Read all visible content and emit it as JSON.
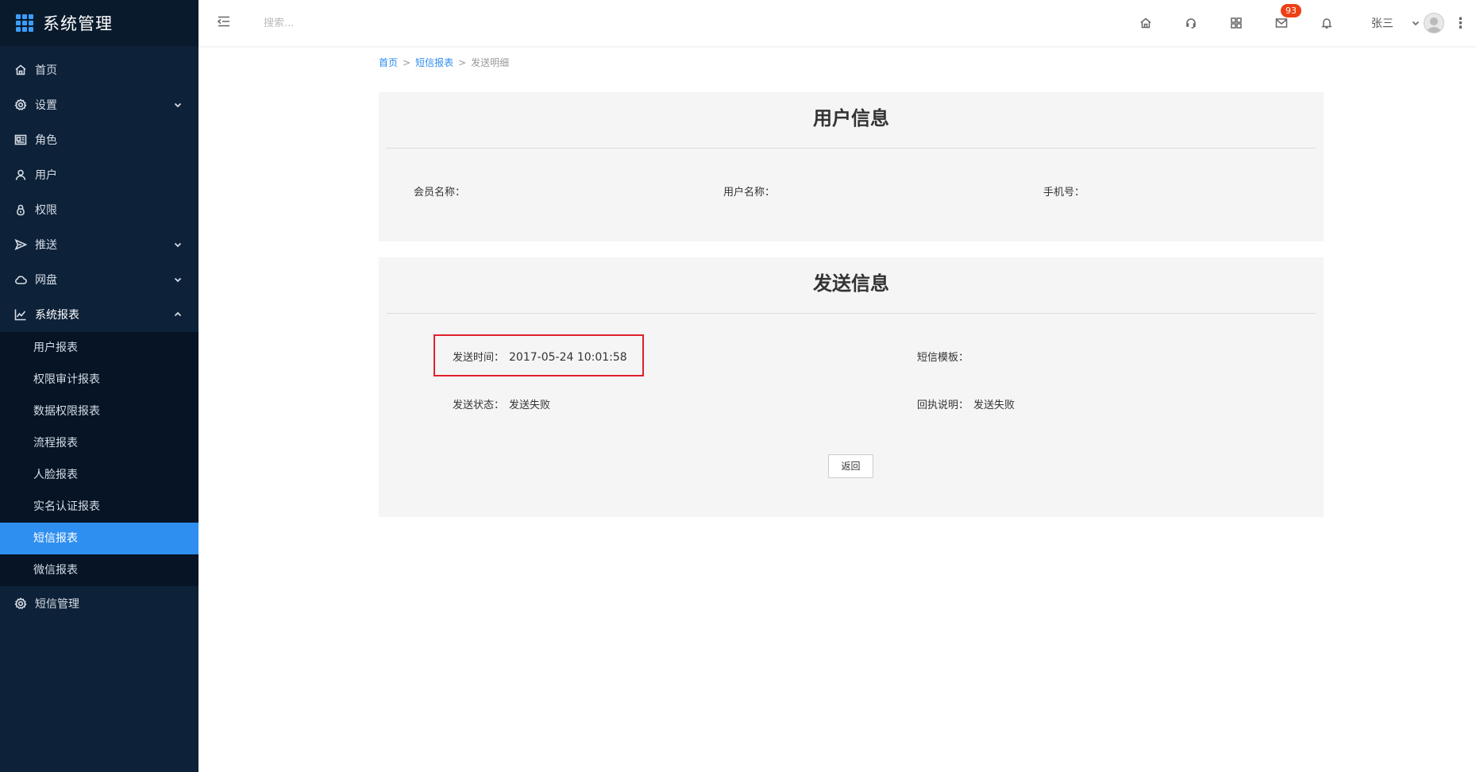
{
  "sidebar": {
    "title": "系统管理",
    "menu": [
      {
        "label": "首页",
        "icon": "home-icon"
      },
      {
        "label": "设置",
        "icon": "settings-icon"
      },
      {
        "label": "角色",
        "icon": "role-icon"
      },
      {
        "label": "用户",
        "icon": "user-icon"
      },
      {
        "label": "权限",
        "icon": "lock-icon"
      },
      {
        "label": "推送",
        "icon": "send-icon"
      },
      {
        "label": "网盘",
        "icon": "cloud-icon"
      },
      {
        "label": "系统报表",
        "icon": "chart-icon"
      }
    ],
    "submenu": [
      "用户报表",
      "权限审计报表",
      "数据权限报表",
      "流程报表",
      "人脸报表",
      "实名认证报表",
      "短信报表",
      "微信报表"
    ],
    "last_item": {
      "label": "短信管理",
      "icon": "settings-icon"
    }
  },
  "header": {
    "search_placeholder": "搜索...",
    "mail_badge": "93",
    "user_name": "张三"
  },
  "breadcrumb": {
    "home": "首页",
    "parent": "短信报表",
    "current": "发送明细",
    "separator": ">"
  },
  "user_info": {
    "title": "用户信息",
    "member_label": "会员名称：",
    "member_value": "",
    "username_label": "用户名称：",
    "username_value": "",
    "phone_label": "手机号：",
    "phone_value": ""
  },
  "send_info": {
    "title": "发送信息",
    "send_time_label": "发送时间：",
    "send_time_value": "2017-05-24 10:01:58",
    "template_label": "短信模板：",
    "template_value": "",
    "status_label": "发送状态：",
    "status_value": "发送失败",
    "receipt_label": "回执说明：",
    "receipt_value": "发送失败"
  },
  "back_button": "返回",
  "colors": {
    "sidebar_bg": "#0d2138",
    "active_item": "#2f8ff0",
    "highlight_border": "#e0202a",
    "badge": "#ed4014"
  }
}
